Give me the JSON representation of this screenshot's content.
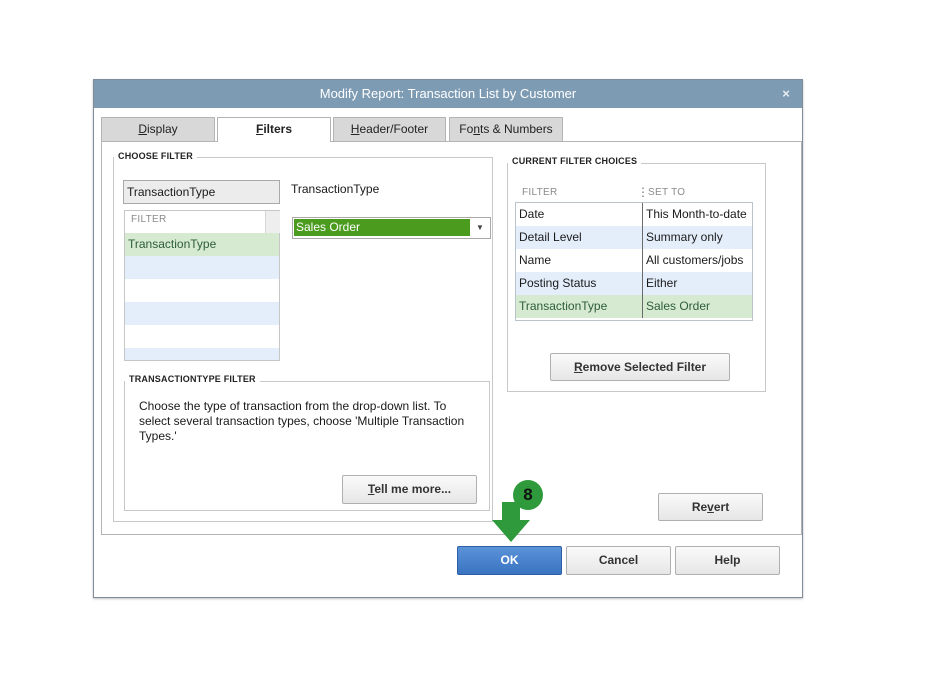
{
  "dialog": {
    "title": "Modify Report: Transaction List by Customer",
    "close_glyph": "×"
  },
  "tabs": [
    {
      "prefix": "",
      "mnemonic": "D",
      "suffix": "isplay",
      "active": false
    },
    {
      "prefix": "",
      "mnemonic": "F",
      "suffix": "ilters",
      "active": true
    },
    {
      "prefix": "",
      "mnemonic": "H",
      "suffix": "eader/Footer",
      "active": false
    },
    {
      "prefix": "Fo",
      "mnemonic": "n",
      "suffix": "ts & Numbers",
      "active": false
    }
  ],
  "choose_filter": {
    "title": "CHOOSE FILTER",
    "search_value": "TransactionType",
    "list_header": "FILTER",
    "items": [
      "TransactionType",
      "",
      "",
      "",
      "",
      ""
    ],
    "selected_label": "TransactionType",
    "dropdown_value": "Sales Order",
    "dropdown_arrow_glyph": "▼"
  },
  "filter_help": {
    "title": "TRANSACTIONTYPE FILTER",
    "text": "Choose the type of transaction from the drop-down list. To select several transaction types, choose 'Multiple Transaction Types.'",
    "tell_me_more": {
      "mnemonic": "T",
      "suffix": "ell me more..."
    }
  },
  "current_choices": {
    "title": "CURRENT FILTER CHOICES",
    "col_filter": "FILTER",
    "col_set_to": "SET TO",
    "col_sep_glyph": "⋮",
    "rows": [
      {
        "filter": "Date",
        "set_to": "This Month-to-date"
      },
      {
        "filter": "Detail Level",
        "set_to": "Summary only"
      },
      {
        "filter": "Name",
        "set_to": "All customers/jobs"
      },
      {
        "filter": "Posting Status",
        "set_to": "Either"
      },
      {
        "filter": "TransactionType",
        "set_to": "Sales Order"
      }
    ],
    "remove_button": {
      "mnemonic": "R",
      "suffix": "emove Selected Filter"
    }
  },
  "buttons": {
    "revert": {
      "prefix": "Re",
      "mnemonic": "v",
      "suffix": "ert"
    },
    "ok": "OK",
    "cancel": "Cancel",
    "help": "Help"
  },
  "annotation": {
    "step_number": "8",
    "color": "#2e9a3b"
  },
  "colors": {
    "titlebar": "#7e9bb4",
    "selection_green": "#4b9b1e",
    "row_highlight": "#d5ead1",
    "row_alt_blue": "#e4eefb",
    "ok_button": "#3a73c1"
  }
}
